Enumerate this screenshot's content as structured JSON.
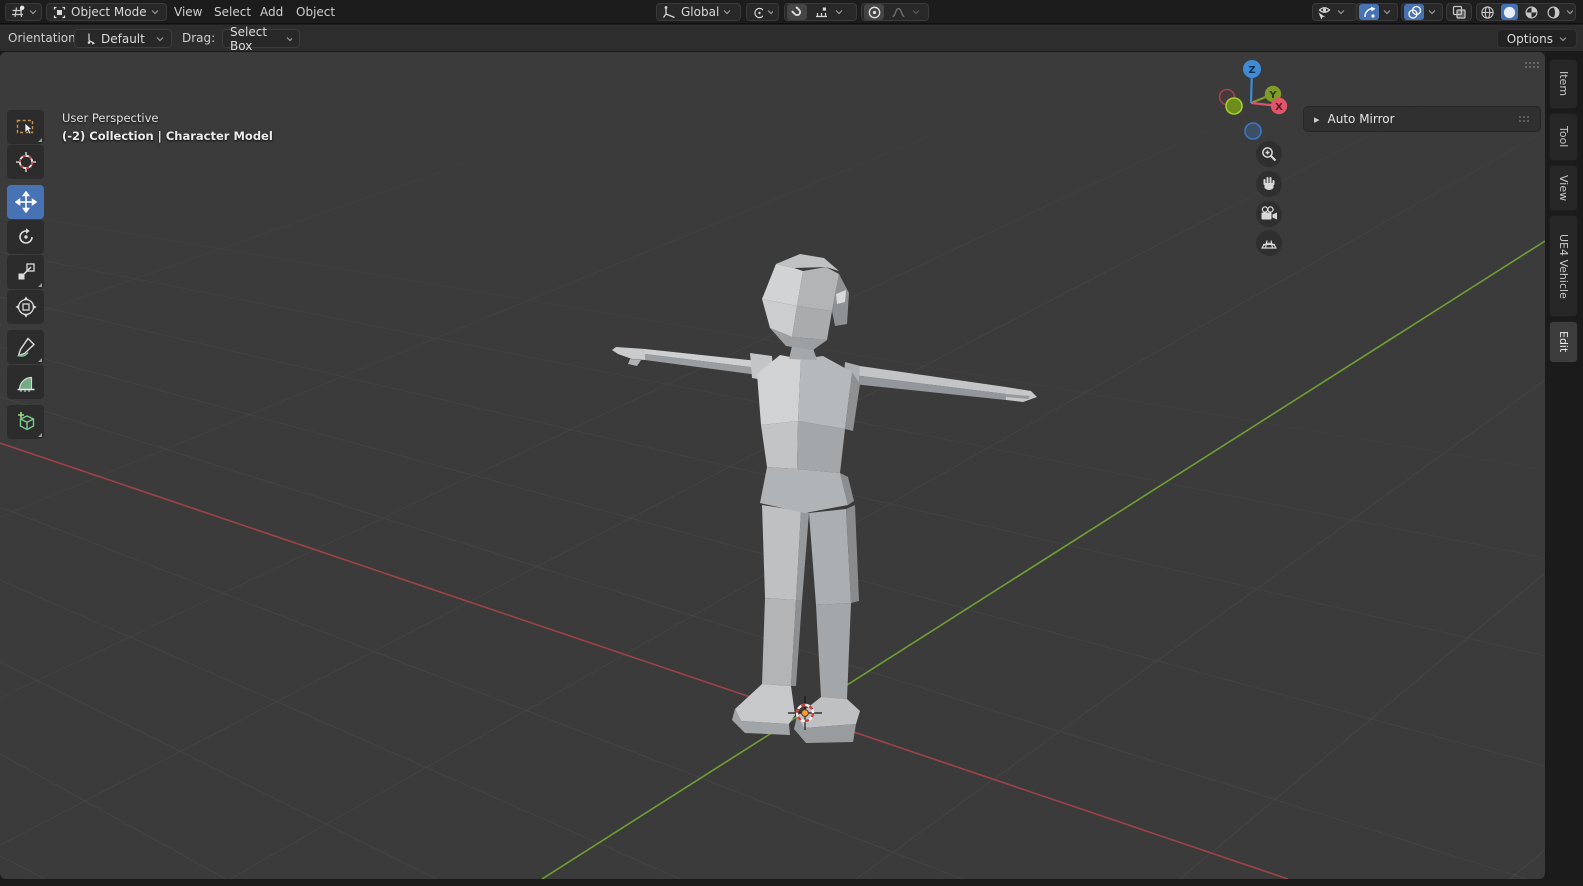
{
  "topbar": {
    "mode_label": "Object Mode",
    "menus": [
      {
        "label": "View"
      },
      {
        "label": "Select"
      },
      {
        "label": "Add"
      },
      {
        "label": "Object"
      }
    ],
    "orientation_value": "Global"
  },
  "tool_settings": {
    "orientation_label": "Orientation:",
    "orientation_value": "Default",
    "drag_label": "Drag:",
    "drag_value": "Select Box",
    "options_label": "Options"
  },
  "viewport": {
    "perspective_label": "User Perspective",
    "breadcrumb": "(-2) Collection | Character Model",
    "panel_auto_mirror": "Auto Mirror",
    "axis": {
      "x": "X",
      "y": "Y",
      "z": "Z"
    }
  },
  "sidebar_tabs": [
    {
      "label": "Item",
      "active": false
    },
    {
      "label": "Tool",
      "active": false
    },
    {
      "label": "View",
      "active": false
    },
    {
      "label": "UE4 Vehicle",
      "active": false
    },
    {
      "label": "Edit",
      "active": true
    }
  ],
  "icons": {
    "editor-type-icon": "grid-with-ball",
    "object-mode-icon": "bracketed-square",
    "snap-magnet-icon": "magnet",
    "proportional-edit-icon": "dot-in-circle",
    "shading-solid-icon": "filled-sphere",
    "move-tool-icon": "four-way-arrows"
  },
  "colors": {
    "accent_blue": "#4772b3",
    "axis_x": "#e0556b",
    "axis_y": "#7d9c28",
    "axis_z": "#3f8cd6",
    "viewport_bg": "#3b3b3b",
    "grid_line": "#474747"
  }
}
